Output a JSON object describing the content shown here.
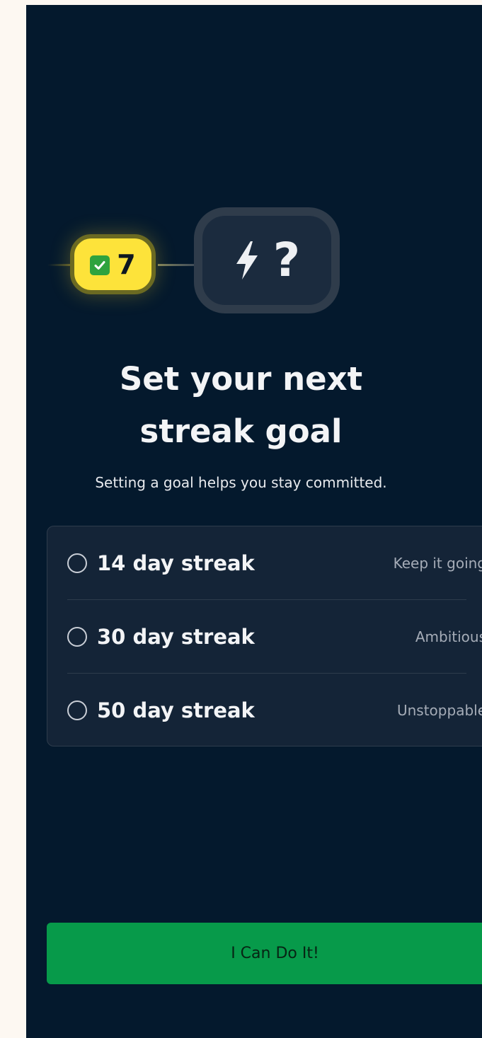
{
  "streak": {
    "current_count": "7",
    "next_goal_symbol": "?"
  },
  "header": {
    "title_line1": "Set your next",
    "title_line2": "streak goal",
    "subtitle": "Setting a goal helps you stay committed."
  },
  "options": [
    {
      "label": "14 day streak",
      "tag": "Keep it going",
      "selected": false
    },
    {
      "label": "30 day streak",
      "tag": "Ambitious",
      "selected": false
    },
    {
      "label": "50 day streak",
      "tag": "Unstoppable",
      "selected": false
    }
  ],
  "cta": {
    "label": "I Can Do It!"
  },
  "icons": {
    "current": "check-icon",
    "goal": "lightning-bolt-icon"
  },
  "colors": {
    "background": "#04192d",
    "badge_yellow": "#fde33a",
    "check_green": "#2ea33e",
    "cta_green": "#079a4a",
    "card_bg": "#142437"
  }
}
